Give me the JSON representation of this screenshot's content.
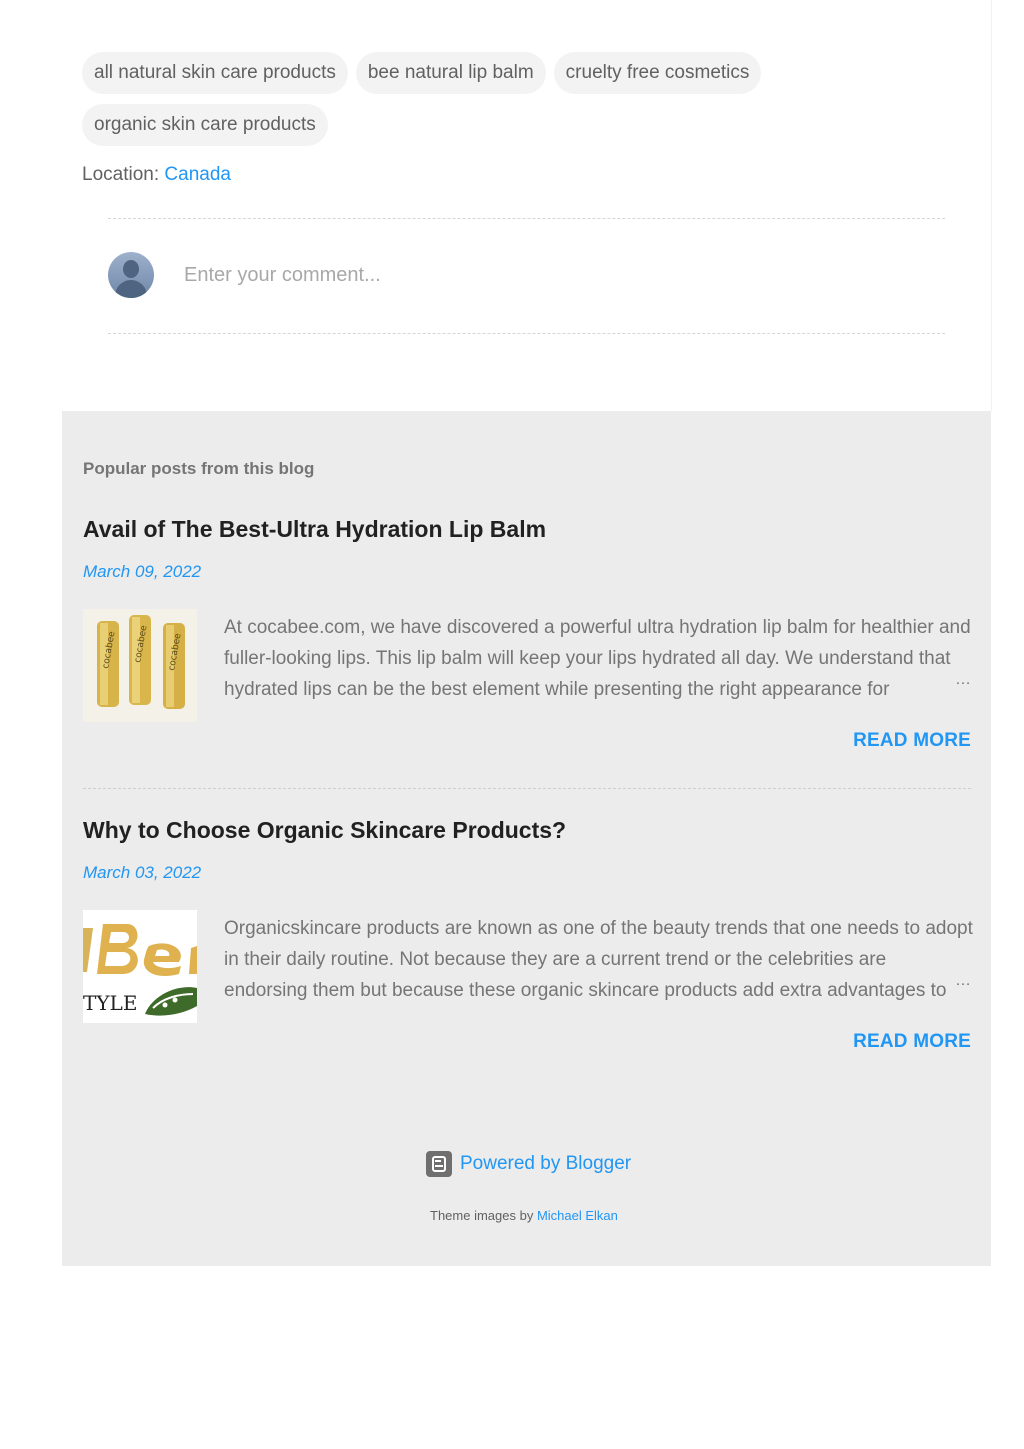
{
  "labels": [
    "all natural skin care products",
    "bee natural lip balm",
    "cruelty free cosmetics",
    "organic skin care products"
  ],
  "location": {
    "label": "Location:",
    "value": "Canada"
  },
  "comment": {
    "placeholder": "Enter your comment..."
  },
  "popular": {
    "heading": "Popular posts from this blog",
    "posts": [
      {
        "title": "Avail of The Best-Ultra Hydration Lip Balm",
        "date": "March 09, 2022",
        "snippet": "At cocabee.com, we have discovered a powerful ultra hydration lip balm for healthier and fuller-looking lips. This lip balm will keep your lips hydrated all day. We understand that hydrated lips can be the best element while presenting the right appearance for",
        "ellipsis": "…",
        "read_more": "READ MORE"
      },
      {
        "title": "Why to Choose Organic Skincare Products?",
        "date": "March 03, 2022",
        "snippet": "Organicskincare products are known as one of the beauty trends that one needs to adopt in their daily routine. Not because they are a current trend or the celebrities are endorsing them but because these organic skincare products add extra advantages to",
        "ellipsis": "…",
        "read_more": "READ MORE"
      }
    ]
  },
  "footer": {
    "powered_by": "Powered by Blogger",
    "theme_prefix": "Theme images by",
    "theme_author": "Michael Elkan"
  },
  "colors": {
    "accent": "#2196f3",
    "panel": "#ececec"
  },
  "icons": {
    "powered": "blogger-icon",
    "avatar": "default-avatar-icon"
  }
}
